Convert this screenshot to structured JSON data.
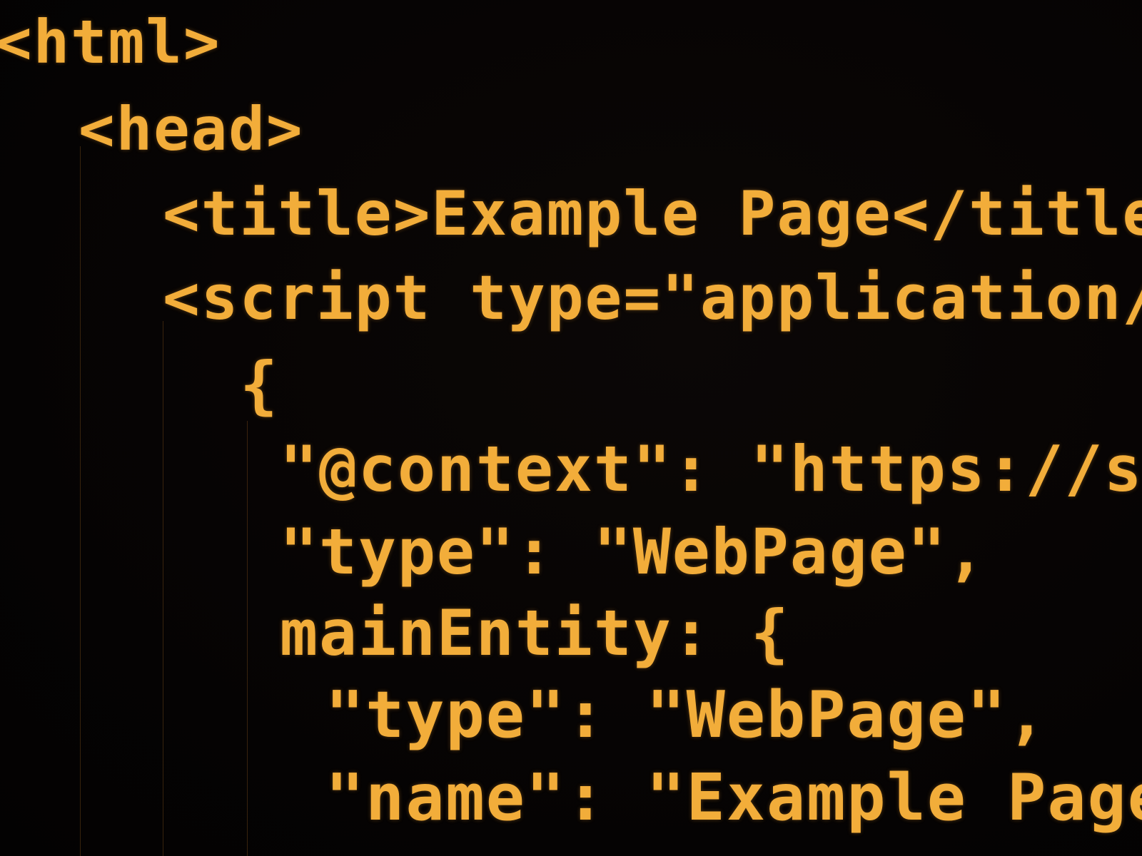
{
  "theme": {
    "background": "#050303",
    "code_color": "#f2ad3a",
    "guide_color": "#be7828"
  },
  "code": {
    "lines": [
      "<html>",
      "<head>",
      "<title>Example Page</title",
      "<script type=\"application/",
      "{",
      "\"@context\": \"https://sc",
      "\"type\": \"WebPage\",",
      "mainEntity: {",
      "\"type\": \"WebPage\",",
      "\"name\": \"Example Page,"
    ]
  }
}
